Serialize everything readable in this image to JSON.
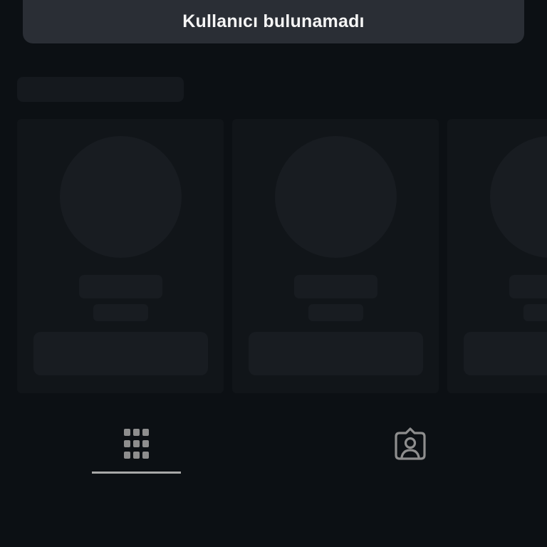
{
  "toast": {
    "message": "Kullanıcı bulunamadı"
  },
  "tabs": [
    {
      "icon": "grid-icon",
      "active": true
    },
    {
      "icon": "tagged-person-icon",
      "active": false
    }
  ],
  "colors": {
    "background": "#0c1014",
    "toast_background": "#2a2e35",
    "toast_text": "#f5f5f5",
    "skeleton_card": "#111519",
    "skeleton_shape": "#181c21",
    "icon": "#8e8e8e",
    "active_indicator": "#a8a8a8"
  }
}
